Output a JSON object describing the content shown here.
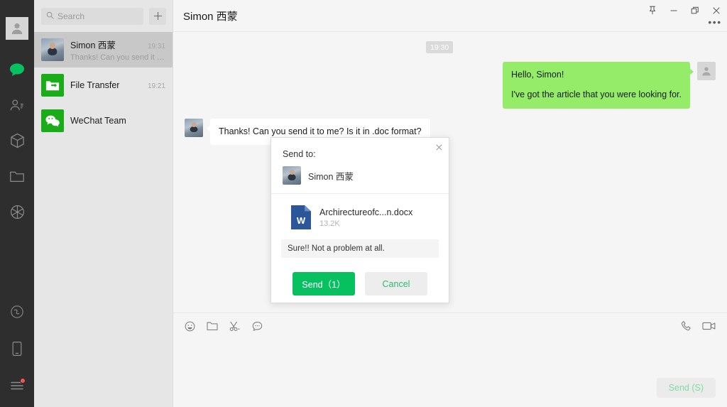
{
  "window": {
    "controls": [
      {
        "name": "pin",
        "icon": "pin-icon",
        "label": "Pin"
      },
      {
        "name": "minimize",
        "icon": "minimize-icon",
        "label": "Minimize"
      },
      {
        "name": "maximize",
        "icon": "maximize-icon",
        "label": "Maximize"
      },
      {
        "name": "close",
        "icon": "close-icon",
        "label": "Close"
      }
    ],
    "more_label": "•••"
  },
  "rail": {
    "avatar_alt": "My profile",
    "items": [
      {
        "name": "chats",
        "icon": "chat-bubble-icon",
        "label": "Chats",
        "active": true
      },
      {
        "name": "contacts",
        "icon": "contacts-icon",
        "label": "Contacts",
        "active": false
      },
      {
        "name": "mini-programs",
        "icon": "box-icon",
        "label": "Mini Programs",
        "active": false
      },
      {
        "name": "favorites",
        "icon": "folder-icon",
        "label": "Favorites",
        "active": false
      },
      {
        "name": "moments",
        "icon": "aperture-icon",
        "label": "Moments",
        "active": false
      }
    ],
    "bottom_items": [
      {
        "name": "mini-program-panel",
        "icon": "mini-program-icon",
        "label": "Mini Program Panel",
        "badge": false
      },
      {
        "name": "phone",
        "icon": "mobile-icon",
        "label": "Phone",
        "badge": false
      },
      {
        "name": "menu",
        "icon": "hamburger-menu-icon",
        "label": "More",
        "badge": true
      }
    ]
  },
  "search": {
    "placeholder": "Search",
    "icon": "search-icon",
    "add_label": "+"
  },
  "chat_list": [
    {
      "name": "Simon 西蒙",
      "time": "19:31",
      "preview": "Thanks! Can you send it to m...",
      "avatar": "photo",
      "selected": true
    },
    {
      "name": "File Transfer",
      "time": "19:21",
      "preview": "",
      "avatar": "file-transfer",
      "selected": false
    },
    {
      "name": "WeChat Team",
      "time": "",
      "preview": "",
      "avatar": "wechat",
      "selected": false
    }
  ],
  "chat": {
    "title": "Simon 西蒙",
    "timestamp_divider": "19:30",
    "messages": [
      {
        "direction": "out",
        "avatar": "blank",
        "lines": [
          "Hello, Simon!",
          "I've got the article that you were looking for."
        ]
      },
      {
        "direction": "in",
        "avatar": "photo",
        "lines": [
          "Thanks! Can you send it to me? Is it in .doc format?"
        ]
      }
    ]
  },
  "composer": {
    "tools": [
      {
        "name": "emoji",
        "icon": "emoji-smiley-icon",
        "label": "Emoji"
      },
      {
        "name": "file",
        "icon": "folder-icon",
        "label": "Send File"
      },
      {
        "name": "screenshot",
        "icon": "scissors-icon",
        "label": "Screenshot"
      },
      {
        "name": "chat-history",
        "icon": "chat-history-icon",
        "label": "Chat History"
      }
    ],
    "right_tools": [
      {
        "name": "voice-call",
        "icon": "phone-icon",
        "label": "Voice Call"
      },
      {
        "name": "video-call",
        "icon": "video-camera-icon",
        "label": "Video Call"
      }
    ],
    "input_value": "",
    "send_label": "Send (S)"
  },
  "dialog": {
    "title": "Send to:",
    "close_icon": "close-icon",
    "recipient": {
      "name": "Simon 西蒙",
      "avatar": "photo"
    },
    "file": {
      "name": "Archirectureofc...n.docx",
      "size": "13.2K",
      "icon": "word-doc-icon"
    },
    "note": "Sure!! Not a problem at all.",
    "send_label": "Send（1）",
    "cancel_label": "Cancel"
  },
  "colors": {
    "brand_green": "#07c160",
    "bubble_green": "#95ec69",
    "rail_dark": "#2e2e2e",
    "list_bg": "#e6e6e6",
    "list_selected": "#c8c8c8",
    "chat_bg": "#f5f5f5",
    "word_blue": "#2b579a",
    "badge_red": "#fa5151"
  }
}
